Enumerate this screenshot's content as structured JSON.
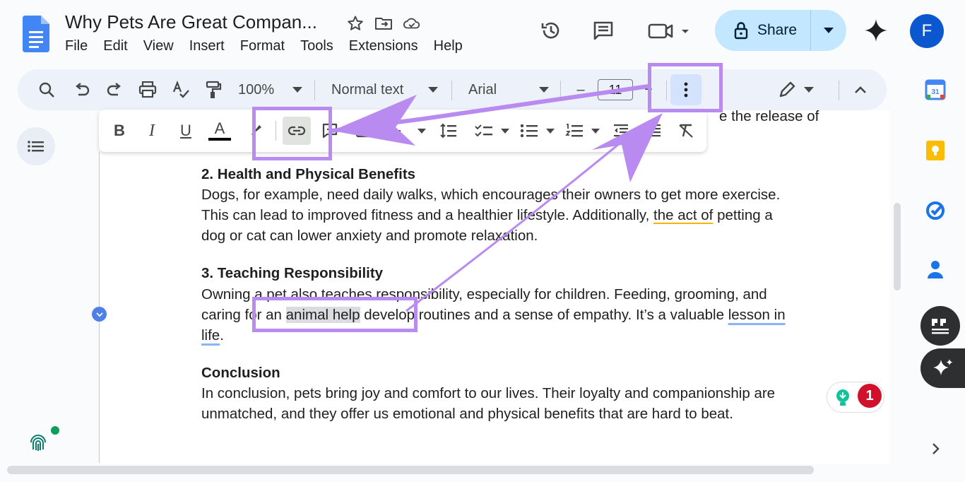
{
  "header": {
    "title": "Why Pets Are Great Compan...",
    "menu": [
      "File",
      "Edit",
      "View",
      "Insert",
      "Format",
      "Tools",
      "Extensions",
      "Help"
    ],
    "share_label": "Share",
    "avatar_letter": "F",
    "icons": [
      "star-icon",
      "move-to-folder-icon",
      "cloud-saved-icon",
      "history-icon",
      "comments-icon",
      "meet-icon",
      "gemini-icon"
    ]
  },
  "toolbar": {
    "zoom": "100%",
    "style": "Normal text",
    "font": "Arial",
    "font_size": "11",
    "minus": "–",
    "plus": "+"
  },
  "format_bar": {
    "buttons": [
      "B",
      "I",
      "U",
      "A"
    ]
  },
  "document": {
    "line0_tail": "e the release of",
    "s2_heading": "2. Health and Physical Benefits",
    "s2_l1": "Dogs, for example, need daily walks, which encourages their owners to get more exercise.",
    "s2_l2a": "This can lead to improved fitness and a healthier lifestyle. Additionally, ",
    "s2_l2b": "the act of",
    "s2_l2c": " petting a",
    "s2_l3": "dog or cat can lower anxiety and promote relaxation.",
    "s3_heading": "3. Teaching Responsibility",
    "s3_l1": "Owning a pet also teaches responsibility, especially for children. Feeding, grooming, and",
    "s3_l2a": "caring for an ",
    "s3_l2b": "animal help",
    "s3_l2c": " develop routines and a sense of empathy. It’s a valuable ",
    "s3_l2d": "lesson in",
    "s3_l3a": "life",
    "s3_l3b": ".",
    "c_heading": "Conclusion",
    "c_l1": "In conclusion, pets bring joy and comfort to our lives. Their loyalty and companionship are",
    "c_l2": "unmatched, and they offer us emotional and physical benefits that are hard to beat."
  },
  "grammarly": {
    "count": "1"
  },
  "colors": {
    "accent": "#0b57d0",
    "share_bg": "#c2e7ff",
    "annotation": "#b98bf0",
    "badge": "#d1112c"
  }
}
